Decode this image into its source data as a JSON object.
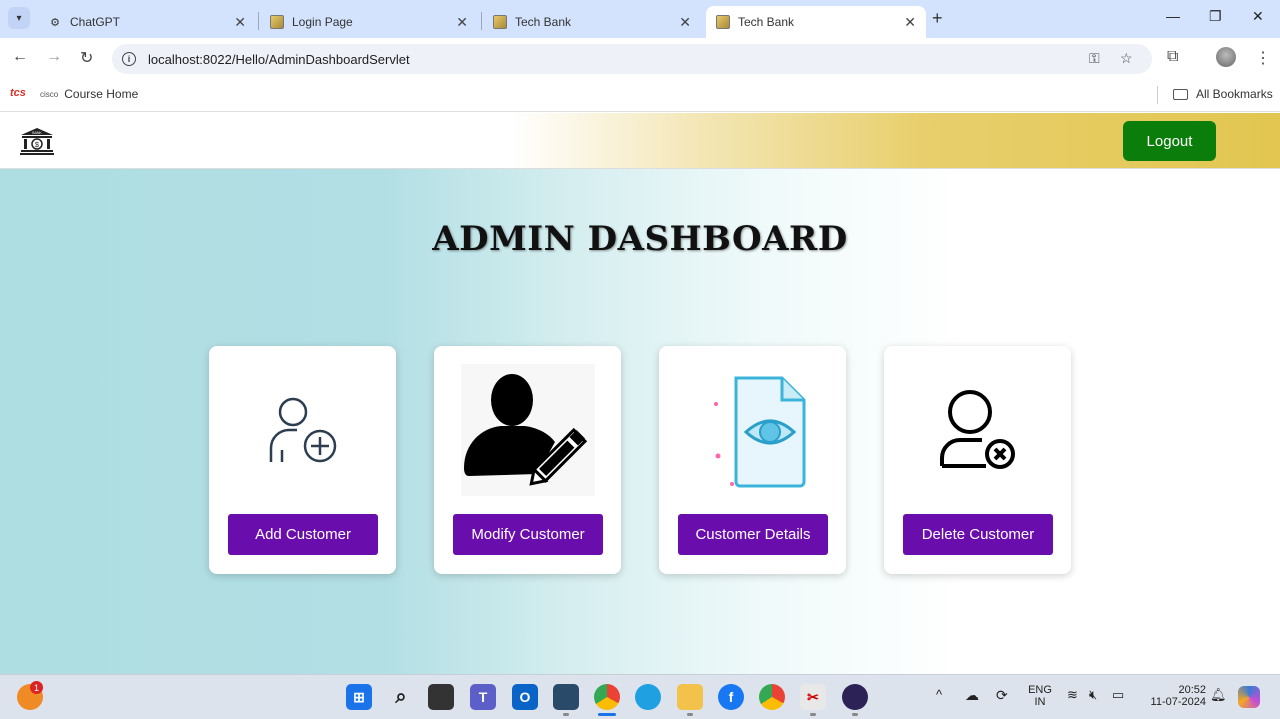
{
  "browser": {
    "tabs": [
      {
        "title": "ChatGPT",
        "active": false
      },
      {
        "title": "Login Page",
        "active": false
      },
      {
        "title": "Tech Bank",
        "active": false
      },
      {
        "title": "Tech Bank",
        "active": true
      }
    ],
    "url": "localhost:8022/Hello/AdminDashboardServlet",
    "bookmarks": {
      "tcs": "tcs",
      "cisco": "cisco",
      "course_home": "Course Home",
      "all_bookmarks": "All Bookmarks"
    }
  },
  "page": {
    "logo_text": "BANK",
    "logout_label": "Logout",
    "title": "ADMIN DASHBOARD",
    "cards": [
      {
        "label": "Add Customer",
        "icon": "add-user-icon"
      },
      {
        "label": "Modify Customer",
        "icon": "edit-user-icon"
      },
      {
        "label": "Customer Details",
        "icon": "view-document-icon"
      },
      {
        "label": "Delete Customer",
        "icon": "delete-user-icon"
      }
    ],
    "colors": {
      "logout": "#0a7d0a",
      "card_button": "#6a0dad"
    }
  },
  "taskbar": {
    "notification_count": "1",
    "lang_top": "ENG",
    "lang_bottom": "IN",
    "time": "20:52",
    "date": "11-07-2024"
  }
}
